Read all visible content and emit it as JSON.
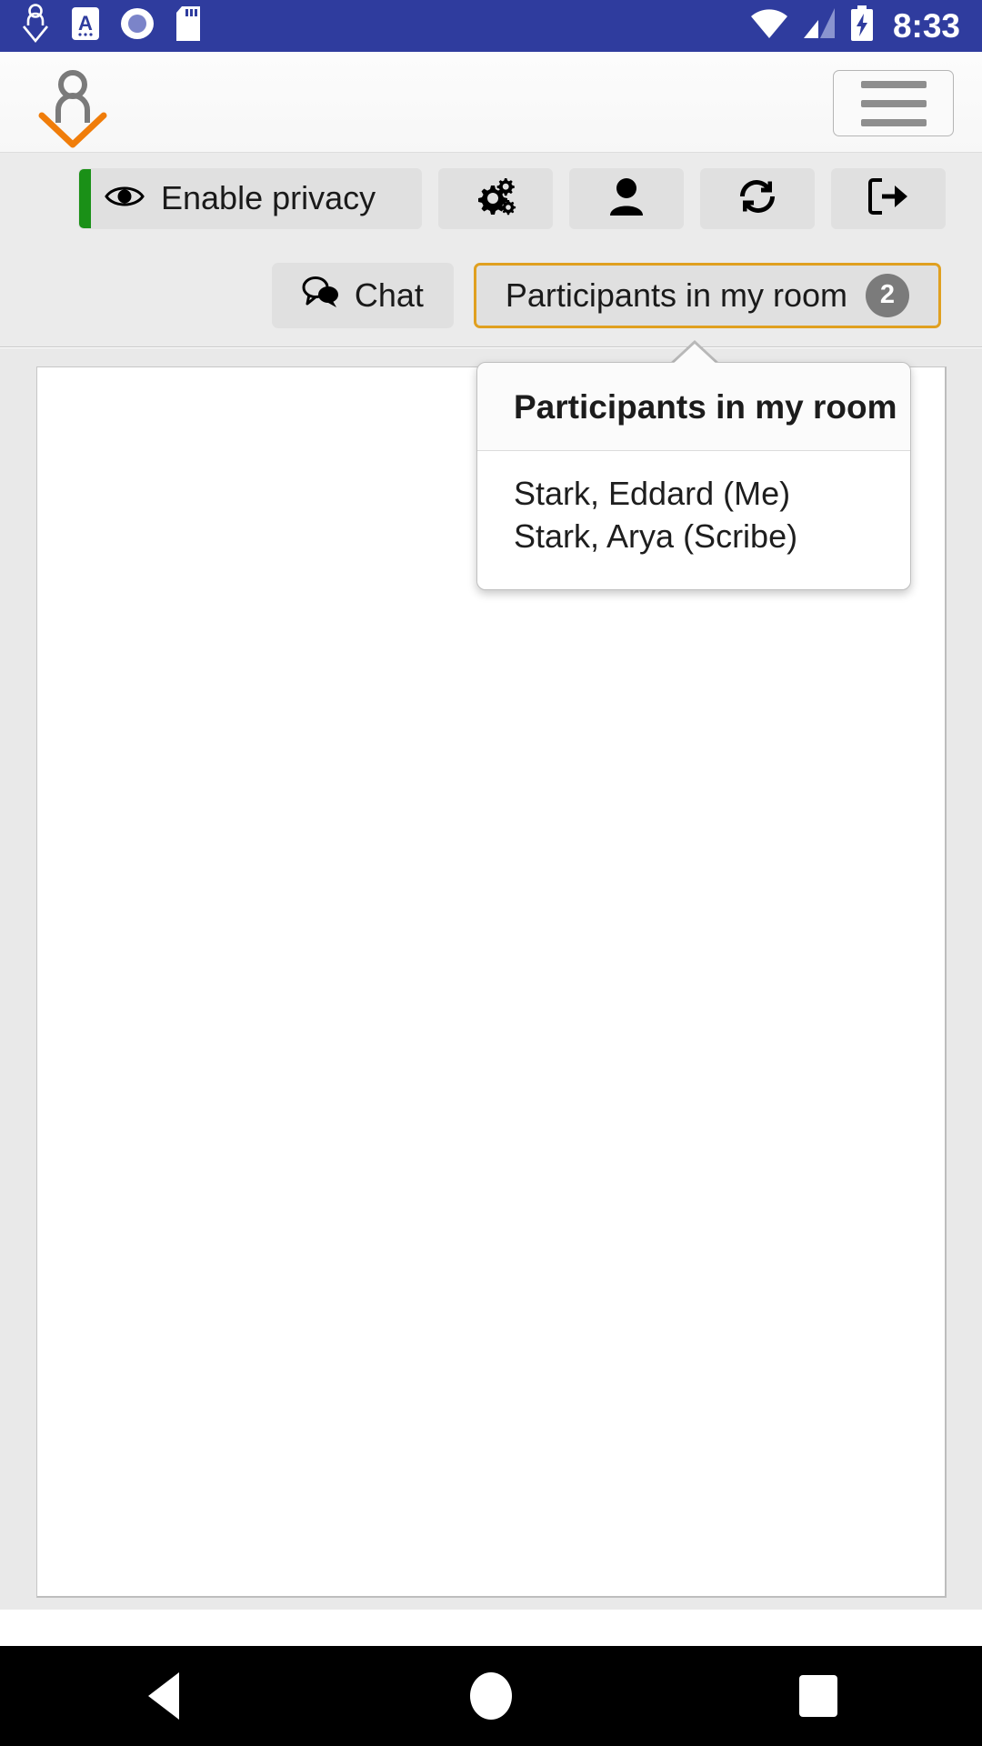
{
  "statusbar": {
    "time": "8:33",
    "left_icons": [
      "download-person-icon",
      "screenshot-a-icon",
      "record-circle-icon",
      "sd-card-icon"
    ],
    "right_icons": [
      "wifi-icon",
      "cell-signal-icon",
      "battery-charging-icon"
    ]
  },
  "header": {
    "brand_icon": "person-check-logo",
    "menu_icon": "hamburger-menu-icon"
  },
  "toolbar": {
    "privacy": {
      "label": "Enable privacy",
      "icon": "eye-icon",
      "accent_color": "#1a9017"
    },
    "buttons": [
      {
        "name": "settings-button",
        "icon": "cogs-icon"
      },
      {
        "name": "user-button",
        "icon": "user-icon"
      },
      {
        "name": "refresh-button",
        "icon": "refresh-icon"
      },
      {
        "name": "logout-button",
        "icon": "sign-out-icon"
      }
    ]
  },
  "tabs": [
    {
      "label": "Chat",
      "icon": "comments-icon",
      "active": false,
      "badge": null
    },
    {
      "label": "Participants in my room",
      "icon": null,
      "active": true,
      "badge": "2"
    }
  ],
  "popover": {
    "title": "Participants in my room",
    "participants": [
      "Stark, Eddard (Me)",
      "Stark, Arya (Scribe)"
    ]
  },
  "navbar": {
    "back": "back-triangle-icon",
    "home": "home-circle-icon",
    "recents": "recents-square-icon"
  },
  "colors": {
    "status_bar": "#2f3c9e",
    "accent_orange": "#e0a020",
    "privacy_green": "#1a9017",
    "badge_gray": "#7b7b7b"
  }
}
